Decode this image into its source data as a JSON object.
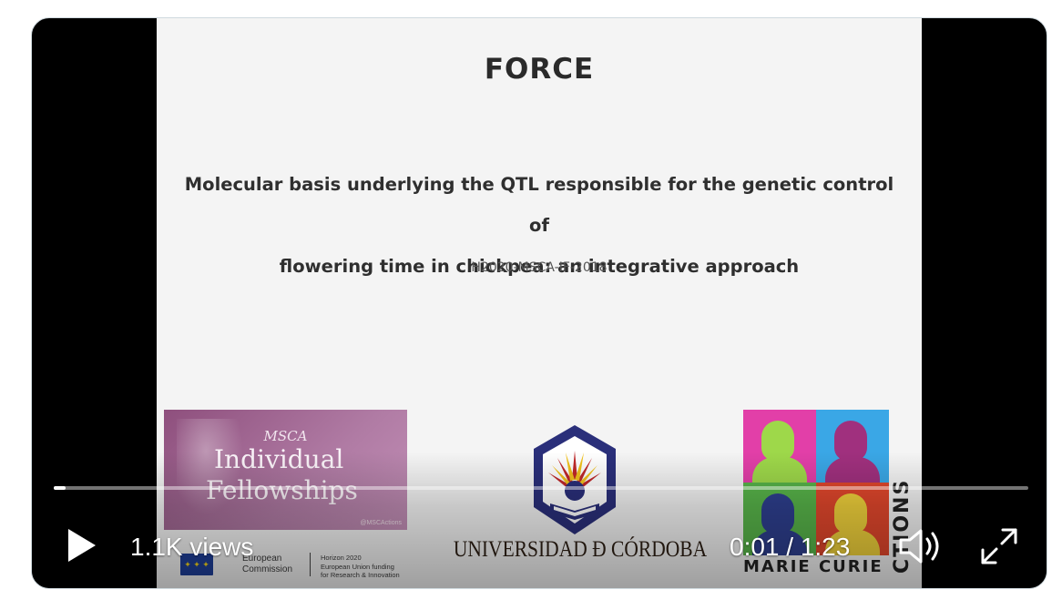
{
  "slide": {
    "title": "FORCE",
    "subtitle_line1": "Molecular basis underlying the QTL responsible for the genetic control of",
    "subtitle_line2": "flowering time in chickpea: an integrative approach",
    "code": "H2020-MSCA-IF-2018"
  },
  "logos": {
    "msca_small": "MSCA",
    "msca_line1": "Individual",
    "msca_line2": "Fellowships",
    "msca_tag": "@MSCActions",
    "eu_line1": "European",
    "eu_line2": "Commission",
    "h2020_line1": "Horizon 2020",
    "h2020_line2": "European Union funding",
    "h2020_line3": "for Research & Innovation",
    "university": "UNIVERSIDAD Ð CÓRDOBA",
    "actions_vertical": "CTIONS",
    "marie_curie": "MARIE CURIE"
  },
  "player": {
    "views": "1.1K views",
    "time": "0:01 / 1:23",
    "progress_fraction": 0.012
  },
  "icons": {
    "play": "play-icon",
    "volume": "volume-icon",
    "fullscreen": "expand-icon"
  },
  "colors": {
    "msca_purple": "#a36a95",
    "eu_blue": "#1f3f9a",
    "uco_navy": "#2a2f7a",
    "uco_red": "#c0282a",
    "uco_gold": "#f2c21c",
    "mc_pink": "#e23fa8",
    "mc_blue": "#3aa7e6",
    "mc_green": "#58b54a",
    "mc_red": "#e2472c"
  }
}
